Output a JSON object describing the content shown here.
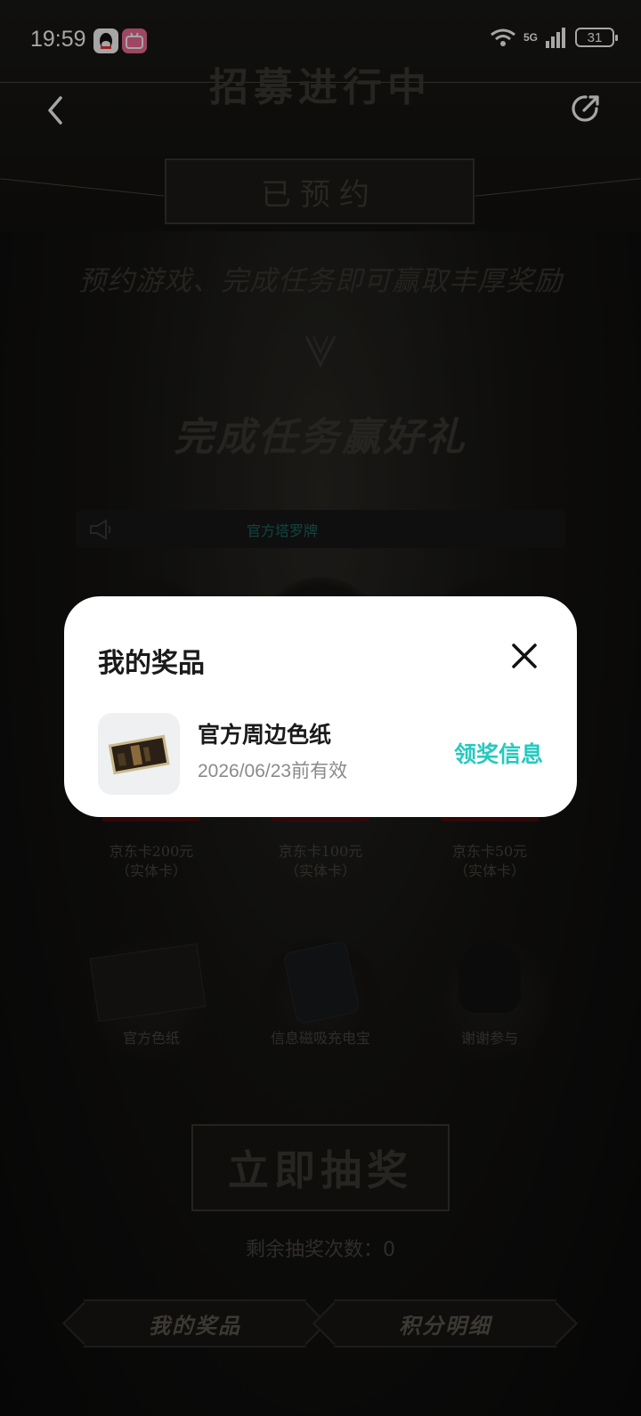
{
  "status_bar": {
    "time": "19:59",
    "network": "5G",
    "battery": "31"
  },
  "banner": {
    "recruit_title": "招募进行中",
    "reserved_label": "已预约",
    "reserve_desc": "预约游戏、完成任务即可赢取丰厚奖励",
    "task_title": "完成任务赢好礼"
  },
  "notice": {
    "highlight": "官方塔罗牌"
  },
  "prizes": [
    {
      "label": "京东卡200元",
      "sub": "（实体卡）",
      "card_value": "200"
    },
    {
      "label": "京东卡100元",
      "sub": "（实体卡）",
      "card_value": "100"
    },
    {
      "label": "京东卡50元",
      "sub": "（实体卡）",
      "card_value": "50"
    },
    {
      "label": "官方色纸",
      "sub": ""
    },
    {
      "label": "信息磁吸充电宝",
      "sub": ""
    },
    {
      "label": "谢谢参与",
      "sub": ""
    }
  ],
  "actions": {
    "draw_button": "立即抽奖",
    "remaining_draws": "剩余抽奖次数：0",
    "my_prizes": "我的奖品",
    "points_detail": "积分明细"
  },
  "modal": {
    "title": "我的奖品",
    "item": {
      "name": "官方周边色纸",
      "expiry": "2026/06/23前有效",
      "claim_label": "领奖信息"
    }
  },
  "colors": {
    "accent_teal": "#26c9be",
    "modal_bg": "#ffffff"
  }
}
